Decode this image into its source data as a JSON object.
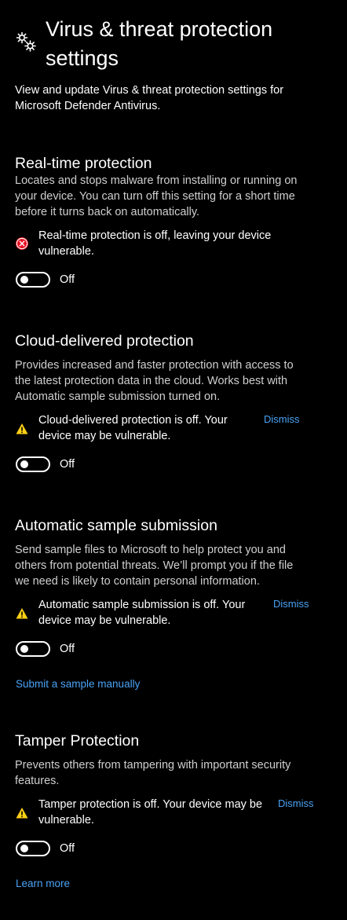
{
  "header": {
    "icon": "gears-icon",
    "title_line1": "Virus & threat protection",
    "title_line2": "settings",
    "subtitle_line1": "View and update Virus & threat protection settings for",
    "subtitle_line2": "Microsoft Defender Antivirus."
  },
  "colors": {
    "background": "#000000",
    "link": "#4aa3f5",
    "error": "#e81123",
    "warning": "#fcd116"
  },
  "sections": {
    "realtime": {
      "title": "Real-time protection",
      "desc": [
        "Locates and stops malware from installing or running on",
        "your device. You can turn off this setting for a short time",
        "before it turns back on automatically."
      ],
      "alert_icon": "error-circle-icon",
      "alert": [
        "Real-time protection is off, leaving your device",
        "vulnerable."
      ],
      "toggle_state": "Off"
    },
    "cloud": {
      "title": "Cloud-delivered protection",
      "desc": [
        "Provides increased and faster protection with access to",
        "the latest protection data in the cloud. Works best with",
        "Automatic sample submission turned on."
      ],
      "alert_icon": "warning-triangle-icon",
      "alert": [
        "Cloud-delivered protection is off. Your",
        "device may be vulnerable."
      ],
      "dismiss": "Dismiss",
      "toggle_state": "Off"
    },
    "sample": {
      "title": "Automatic sample submission",
      "desc": [
        "Send sample files to Microsoft to help protect you and",
        "others from potential threats. We’ll prompt you if the file",
        "we need is likely to contain personal information."
      ],
      "alert_icon": "warning-triangle-icon",
      "alert": [
        "Automatic sample submission is off. Your",
        "device may be vulnerable."
      ],
      "dismiss": "Dismiss",
      "toggle_state": "Off",
      "link": "Submit a sample manually"
    },
    "tamper": {
      "title": "Tamper Protection",
      "desc": [
        "Prevents others from tampering with important security",
        "features."
      ],
      "alert_icon": "warning-triangle-icon",
      "alert": [
        "Tamper protection is off. Your device may be",
        "vulnerable."
      ],
      "dismiss": "Dismiss",
      "toggle_state": "Off",
      "link": "Learn more"
    }
  }
}
